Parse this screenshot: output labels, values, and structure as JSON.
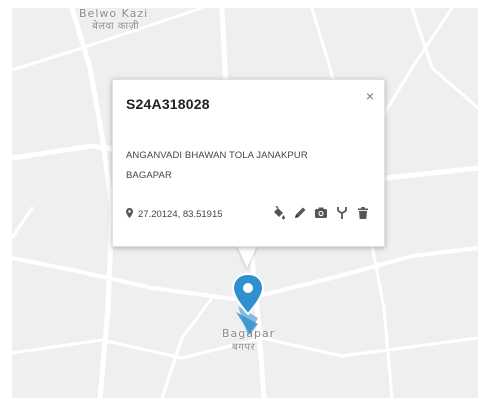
{
  "map": {
    "places": [
      {
        "name_en": "Belwo Kazi",
        "name_hi": "बेलवा काज़ी"
      },
      {
        "name_en": "Bagapar",
        "name_hi": "बगपर"
      }
    ]
  },
  "popup": {
    "title": "S24A318028",
    "close_label": "×",
    "address_line1": "ANGANVADI BHAWAN TOLA JANAKPUR",
    "address_line2": "BAGAPAR",
    "coordinates": "27.20124, 83.51915",
    "actions": [
      "paint-bucket-icon",
      "pencil-icon",
      "camera-icon",
      "fork-icon",
      "trash-icon"
    ]
  },
  "colors": {
    "marker": "#2f8fd0",
    "icon": "#555555"
  }
}
